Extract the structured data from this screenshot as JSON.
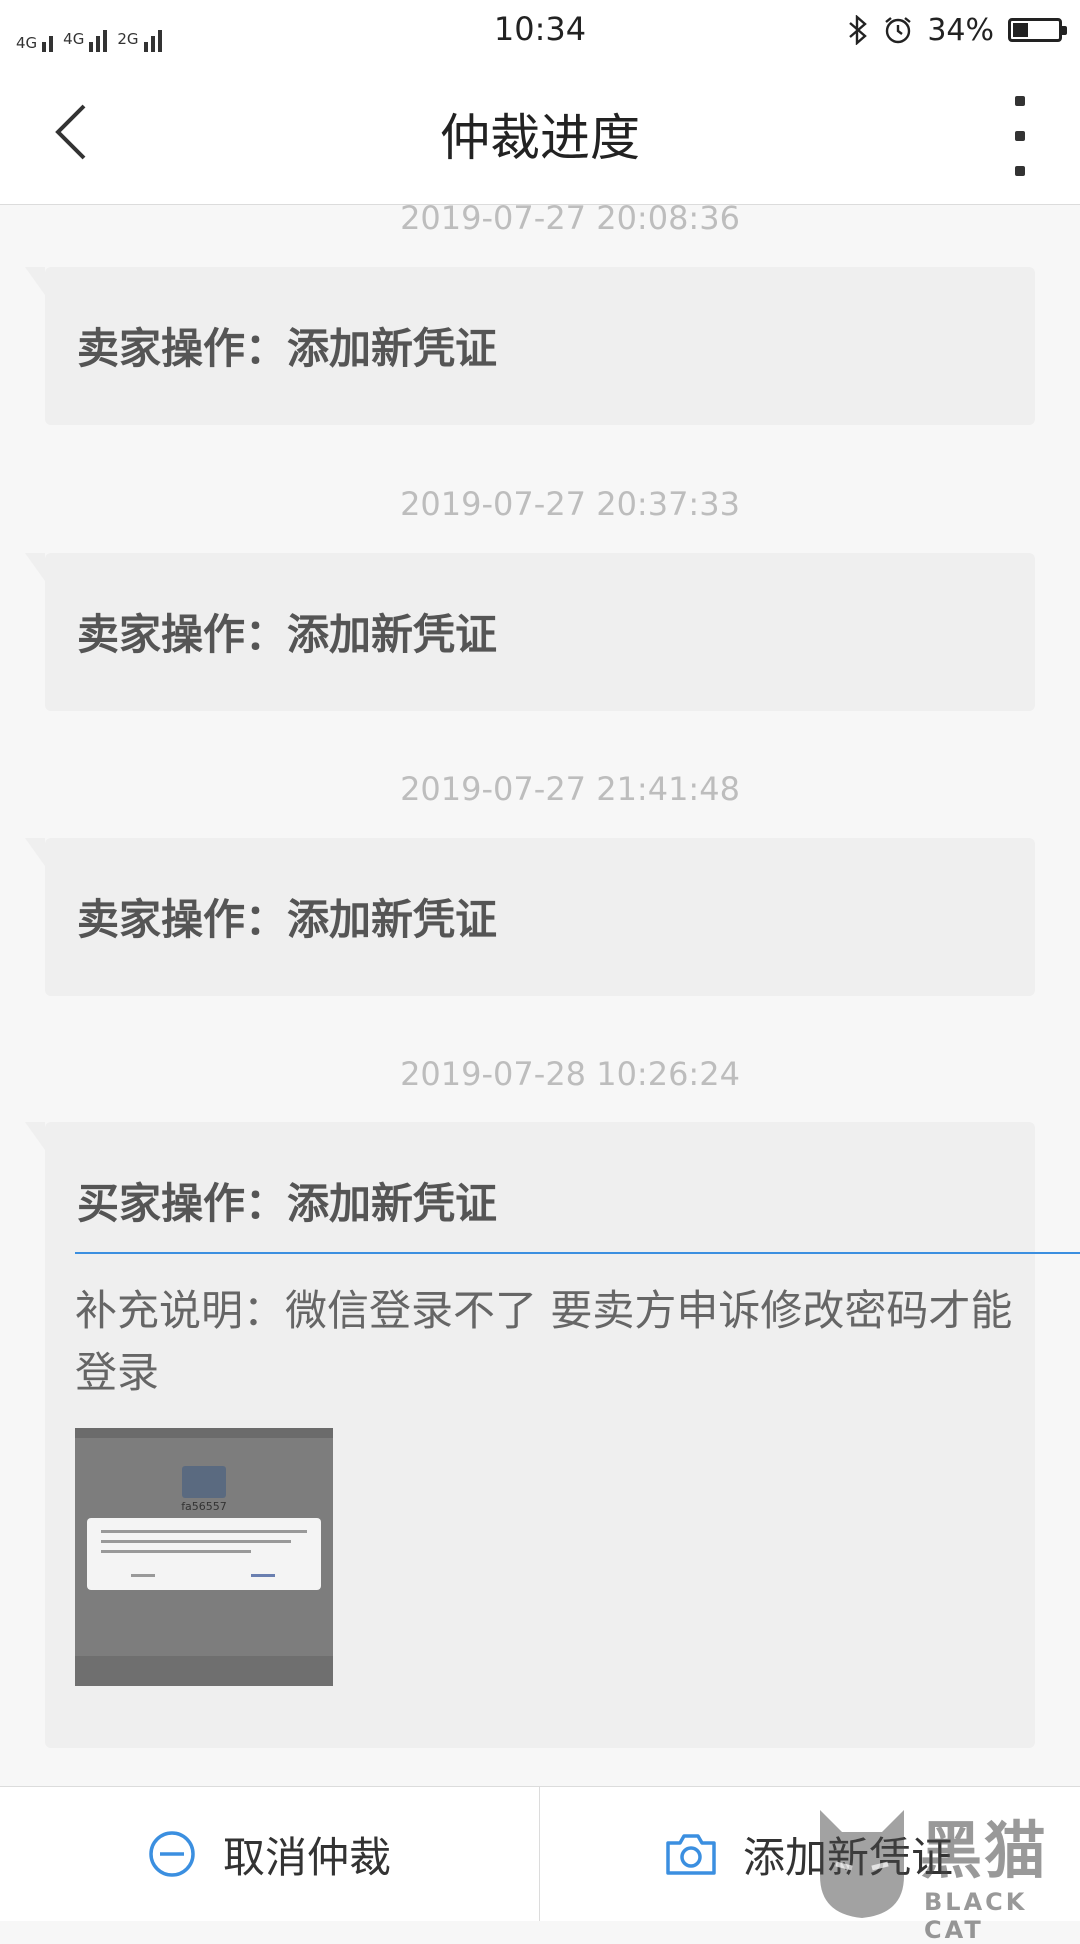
{
  "status_bar": {
    "network_1": "4G",
    "network_2": "4G",
    "network_3": "2G",
    "time": "10:34",
    "battery_percent": "34%",
    "battery_level": 0.34,
    "icons": [
      "bluetooth-icon",
      "alarm-icon",
      "battery-icon"
    ]
  },
  "header": {
    "title": "仲裁进度",
    "back_icon": "chevron-left-icon",
    "more_icon": "more-vertical-icon"
  },
  "timeline": [
    {
      "timestamp": "2019-07-27 20:08:36",
      "operation": "卖家操作：添加新凭证"
    },
    {
      "timestamp": "2019-07-27 20:37:33",
      "operation": "卖家操作：添加新凭证"
    },
    {
      "timestamp": "2019-07-27 21:41:48",
      "operation": "卖家操作：添加新凭证"
    },
    {
      "timestamp": "2019-07-28 10:26:24",
      "operation": "买家操作：添加新凭证",
      "note": "补充说明：微信登录不了 要卖方申诉修改密码才能登录",
      "attachment_caption": "fa56557"
    }
  ],
  "bottom_bar": {
    "cancel_label": "取消仲裁",
    "cancel_icon": "minus-circle-icon",
    "add_label": "添加新凭证",
    "add_icon": "camera-icon"
  },
  "watermark": {
    "cn": "黑猫",
    "en": "BLACK CAT"
  },
  "colors": {
    "accent_blue": "#3b8fe0",
    "bubble_bg": "#efefef",
    "timestamp_gray": "#bdbdbd"
  }
}
